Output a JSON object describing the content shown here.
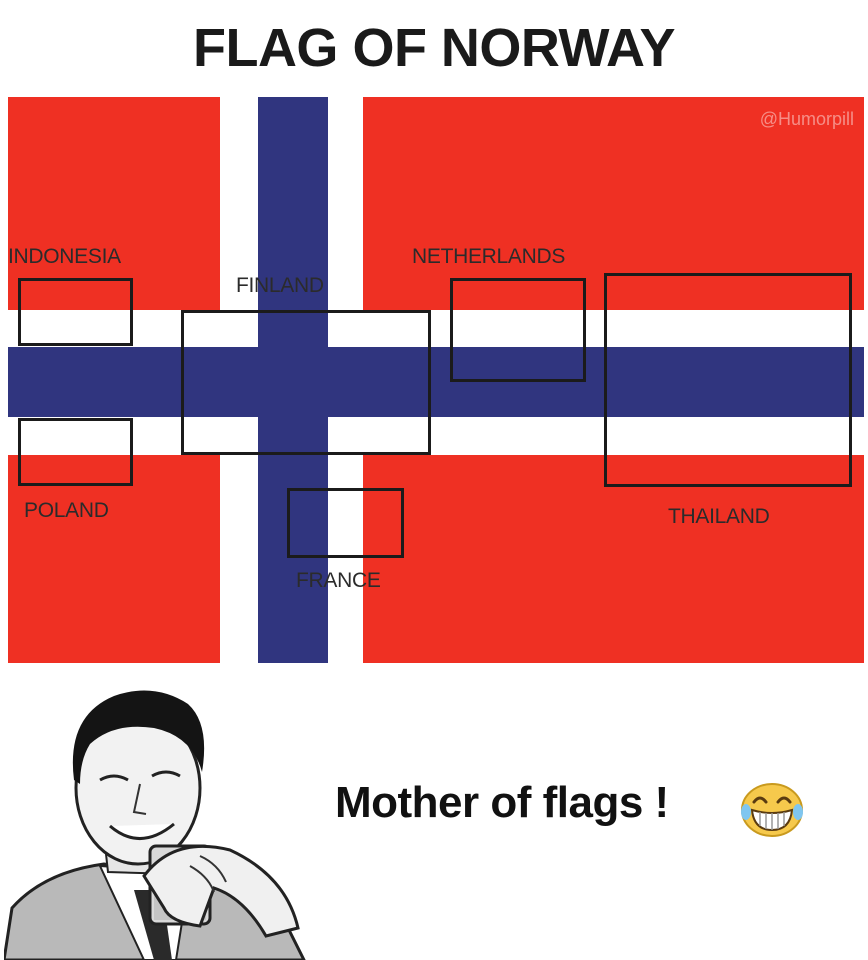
{
  "title": "FLAG OF NORWAY",
  "watermark": "@Humorpill",
  "flag_colors": {
    "red": "#ef3023",
    "white": "#ffffff",
    "blue": "#30357f"
  },
  "regions": [
    {
      "id": "indonesia",
      "label": "INDONESIA"
    },
    {
      "id": "finland",
      "label": "FINLAND"
    },
    {
      "id": "netherlands",
      "label": "NETHERLANDS"
    },
    {
      "id": "poland",
      "label": "POLAND"
    },
    {
      "id": "thailand",
      "label": "THAILAND"
    },
    {
      "id": "france",
      "label": "FRANCE"
    }
  ],
  "caption": "Mother of flags !",
  "icons": {
    "emoji": "laughing-emoji-icon",
    "illustration": "laughing-man-drinking-illustration"
  }
}
